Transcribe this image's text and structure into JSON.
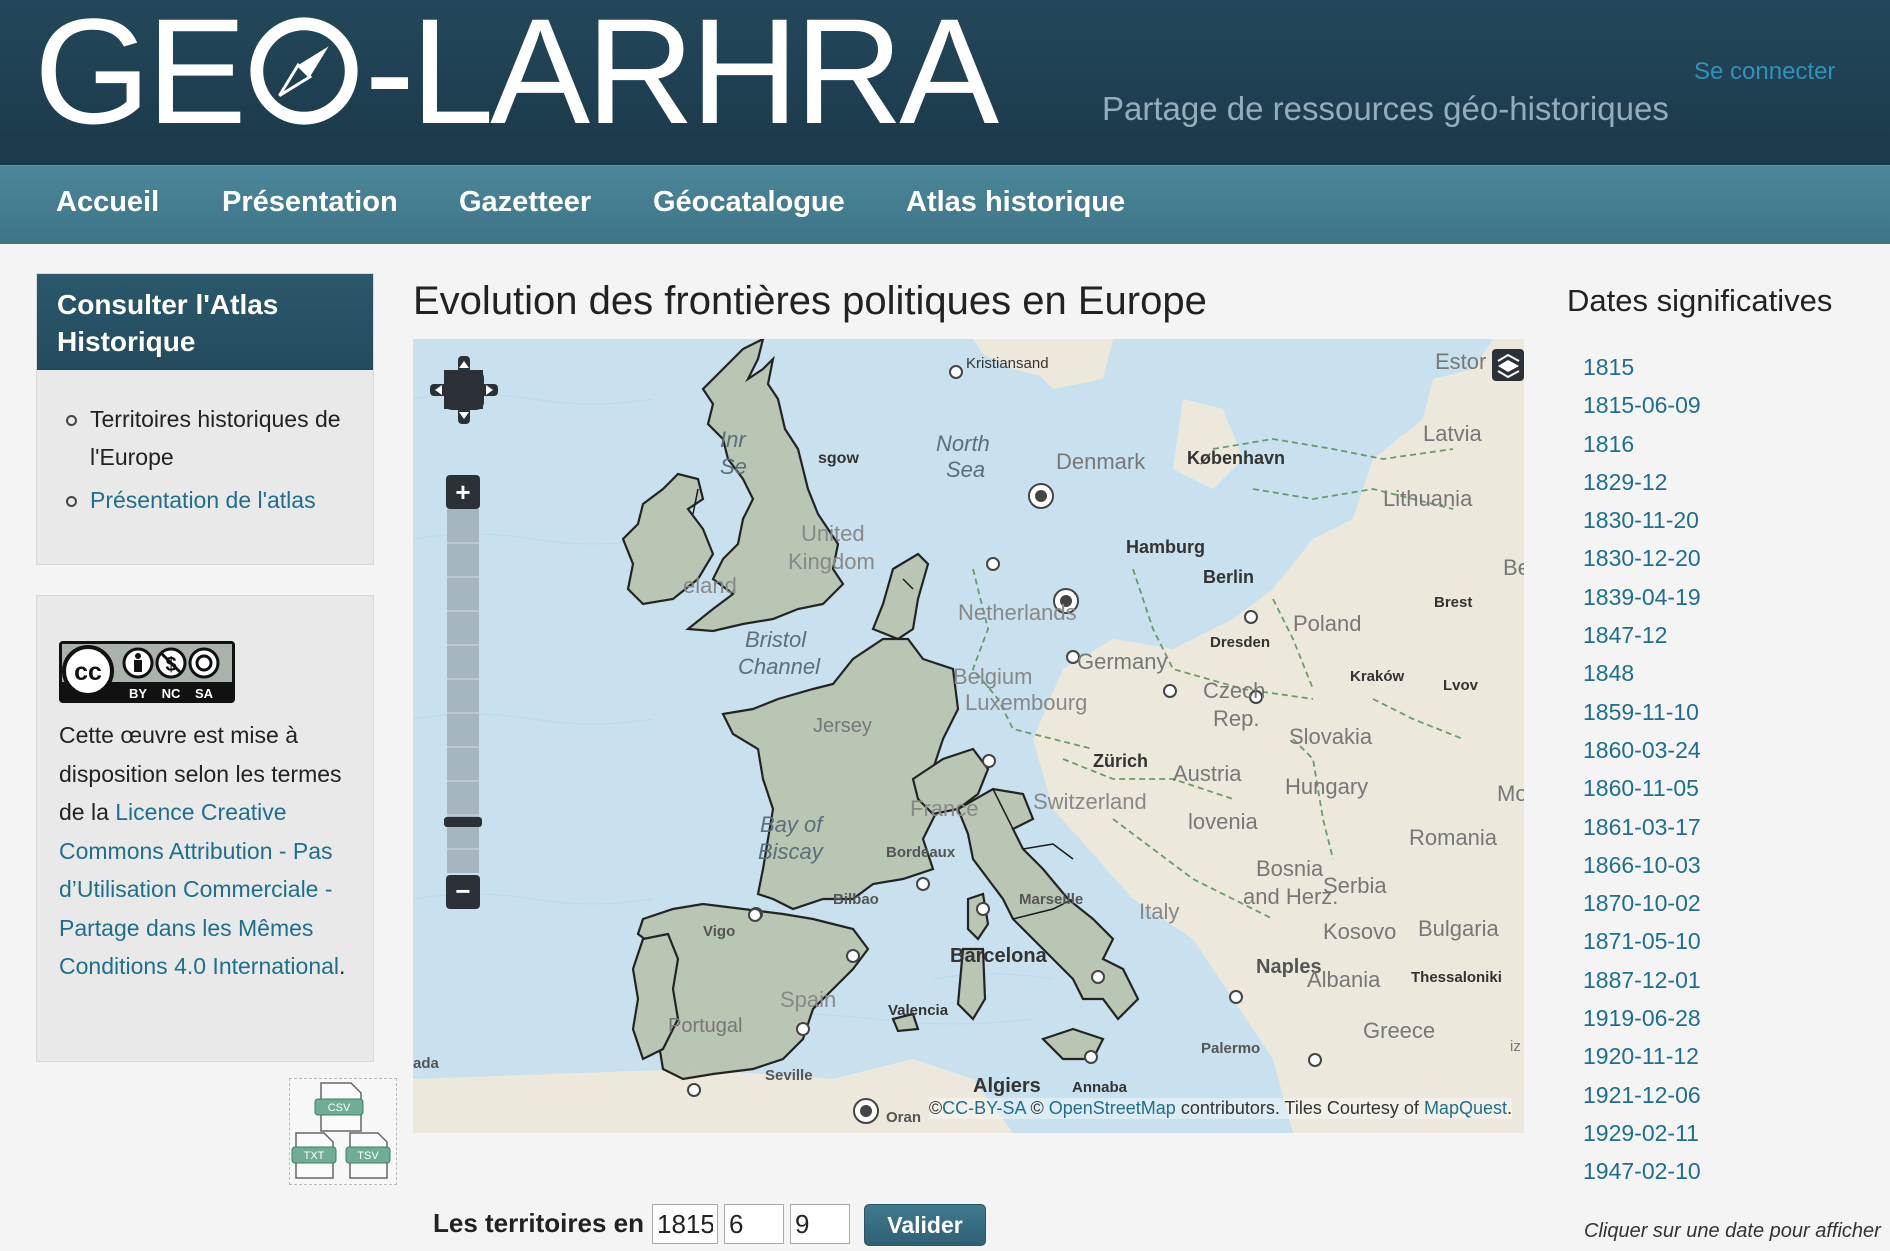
{
  "header": {
    "logo_left": "GE",
    "logo_right": "-LARHRA",
    "tagline": "Partage de ressources géo-historiques",
    "login": "Se connecter"
  },
  "nav": {
    "items": [
      {
        "label": "Accueil"
      },
      {
        "label": "Présentation"
      },
      {
        "label": "Gazetteer"
      },
      {
        "label": "Géocatalogue"
      },
      {
        "label": "Atlas historique"
      }
    ]
  },
  "sidebar": {
    "block_title": "Consulter l'Atlas Historique",
    "links": [
      {
        "label": "Territoires historiques de l'Europe"
      },
      {
        "label": "Présentation de l'atlas"
      }
    ],
    "license": {
      "badge": {
        "cc": "cc",
        "by": "BY",
        "nc": "NC",
        "sa": "SA"
      },
      "text_before": "Cette œuvre est mise à disposition selon les termes de la ",
      "link": "Licence Creative Commons Attribution - Pas d’Utilisation Commerciale - Partage dans les Mêmes Conditions 4.0 International",
      "text_after": "."
    },
    "exports": [
      {
        "label": "CSV"
      },
      {
        "label": "TXT"
      },
      {
        "label": "TSV"
      }
    ]
  },
  "main": {
    "title": "Evolution des frontières politiques en Europe",
    "map": {
      "zoom_in": "+",
      "zoom_out": "−",
      "labels": {
        "kristiansand": "Kristiansand",
        "estonia": "Estor",
        "latvia": "Latvia",
        "north_sea_1": "North",
        "north_sea_2": "Sea",
        "denmark": "Denmark",
        "kobenhavn": "København",
        "lithuania": "Lithuania",
        "inner_seas_1": "Inr",
        "inner_seas_2": "Se",
        "glasgow": "sgow",
        "hamburg": "Hamburg",
        "berlin": "Berlin",
        "belarus": "Bela",
        "united_kingdom_1": "United",
        "united_kingdom_2": "Kingdom",
        "ireland": "eland",
        "brest": "Brest",
        "netherlands": "Netherlands",
        "poland": "Poland",
        "bristol_channel_1": "Bristol",
        "bristol_channel_2": "Channel",
        "dresden": "Dresden",
        "germany": "Germany",
        "krakow": "Kraków",
        "lvov": "Lvov",
        "belgium": "Belgium",
        "czech_1": "Czech",
        "czech_2": "Rep.",
        "luxembourg": "Luxembourg",
        "jersey": "Jersey",
        "slovakia": "Slovakia",
        "zurich": "Zürich",
        "austria": "Austria",
        "hungary": "Hungary",
        "moldova": "Mo",
        "france": "France",
        "switzerland": "Switzerland",
        "bay_1": "Bay of",
        "bay_2": "Biscay",
        "bordeaux": "Bordeaux",
        "slovenia": "lovenia",
        "romania": "Romania",
        "bosnia_1": "Bosnia",
        "bosnia_2": "and Herz.",
        "serbia": "Serbia",
        "bilbao": "Bilbao",
        "marseille": "Marseille",
        "italy": "Italy",
        "kosovo": "Kosovo",
        "bulgaria": "Bulgaria",
        "vigo": "Vigo",
        "barcelona": "Barcelona",
        "naples": "Naples",
        "albania": "Albania",
        "thessaloniki": "Thessaloniki",
        "spain": "Spain",
        "valencia": "Valencia",
        "portugal": "Portugal",
        "greece": "Greece",
        "palermo": "Palermo",
        "seville": "Seville",
        "algiers": "Algiers",
        "annaba": "Annaba",
        "oran": "Oran",
        "ada": "ada",
        "iz": "iz"
      },
      "attribution": {
        "prefix": "©",
        "cc": "CC-BY-SA",
        "sep": " © ",
        "osm": "OpenStreetMap",
        "contrib": " contributors.",
        "tiles": " Tiles Courtesy of ",
        "mapquest": "MapQuest",
        "end": "."
      }
    },
    "form": {
      "label": "Les territoires en",
      "year": "1815",
      "month": "6",
      "day": "9",
      "submit": "Valider"
    }
  },
  "dates": {
    "title": "Dates significatives",
    "items": [
      "1815",
      "1815-06-09",
      "1816",
      "1829-12",
      "1830-11-20",
      "1830-12-20",
      "1839-04-19",
      "1847-12",
      "1848",
      "1859-11-10",
      "1860-03-24",
      "1860-11-05",
      "1861-03-17",
      "1866-10-03",
      "1870-10-02",
      "1871-05-10",
      "1887-12-01",
      "1919-06-28",
      "1920-11-12",
      "1921-12-06",
      "1929-02-11",
      "1947-02-10"
    ],
    "hint": "Cliquer sur une date pour afficher"
  },
  "colors": {
    "header_bg": "#1f4253",
    "nav_bg": "#437d90",
    "accent_link": "#1f6f8b",
    "sea": "#c7e1ef",
    "land": "#ece9dc",
    "territory_fill": "#b8c4b0",
    "border": "#1a1a1a"
  }
}
